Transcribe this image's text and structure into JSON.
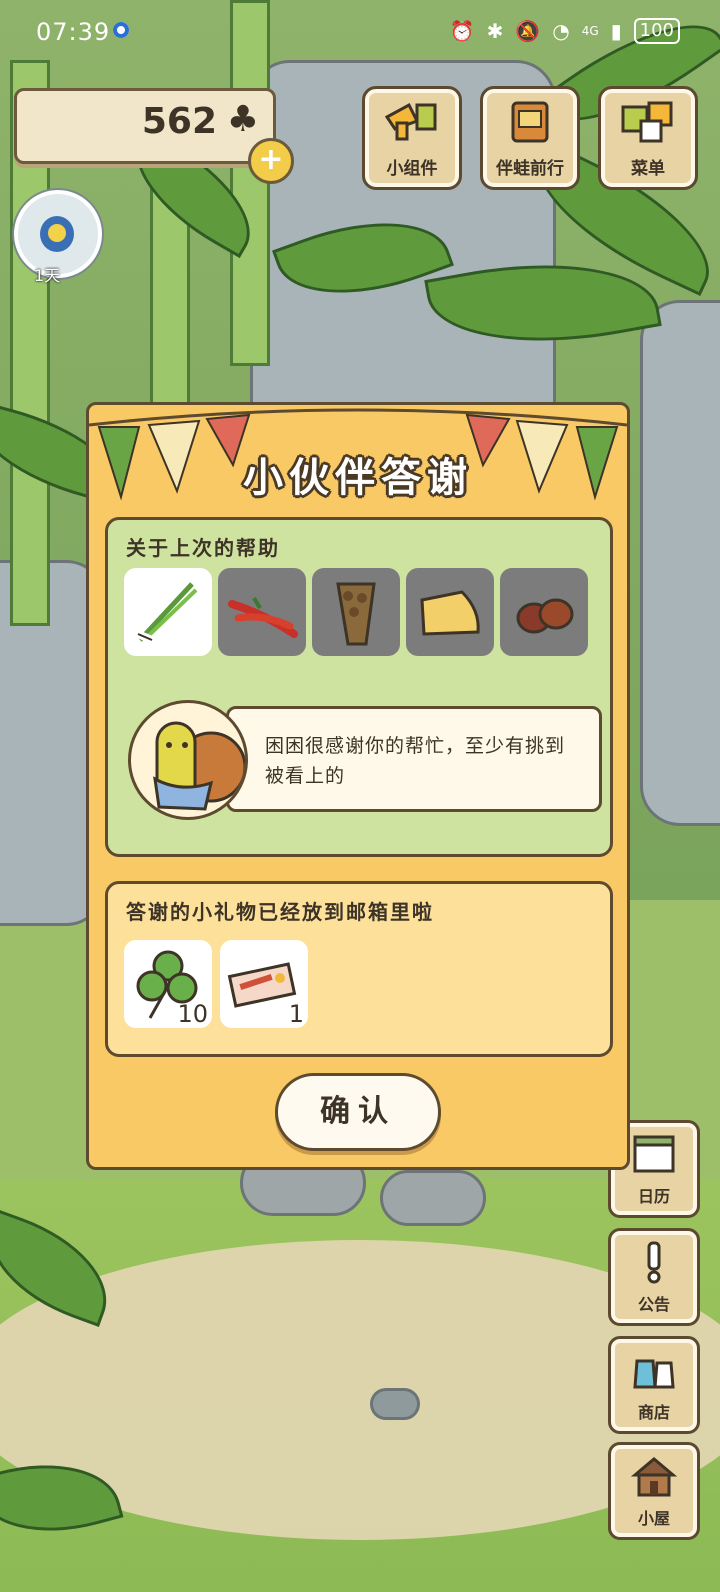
{
  "status_bar": {
    "time": "07:39",
    "network": "4G",
    "battery": "100"
  },
  "top": {
    "clover_count": "562",
    "avatar_days": "1天",
    "buttons": [
      {
        "label": "小组件",
        "icon": "widget-icon"
      },
      {
        "label": "伴蛙前行",
        "icon": "journey-icon"
      },
      {
        "label": "菜单",
        "icon": "menu-icon"
      }
    ]
  },
  "side": {
    "buttons": [
      {
        "label": "日历",
        "icon": "calendar-icon"
      },
      {
        "label": "公告",
        "icon": "notice-icon"
      },
      {
        "label": "商店",
        "icon": "shop-icon"
      },
      {
        "label": "小屋",
        "icon": "house-icon"
      }
    ]
  },
  "dialog": {
    "title": "小伙伴答谢",
    "section1": {
      "heading": "关于上次的帮助",
      "items": [
        {
          "icon": "green-onion-icon",
          "selected": true
        },
        {
          "icon": "chili-pepper-icon",
          "selected": false
        },
        {
          "icon": "pinecone-icon",
          "selected": false
        },
        {
          "icon": "cheese-icon",
          "selected": false
        },
        {
          "icon": "chestnut-icon",
          "selected": false
        }
      ],
      "speech": "困困很感谢你的帮忙，至少有挑到被看上的"
    },
    "section2": {
      "heading": "答谢的小礼物已经放到邮箱里啦",
      "gifts": [
        {
          "icon": "clover-icon",
          "count": "10"
        },
        {
          "icon": "ticket-icon",
          "count": "1"
        }
      ]
    },
    "confirm_label": "确认"
  },
  "colors": {
    "dialog_bg": "#f9c966",
    "panel_green": "#cfe3a0",
    "panel_yellow": "#fde09a",
    "outline": "#5e4b2f"
  }
}
